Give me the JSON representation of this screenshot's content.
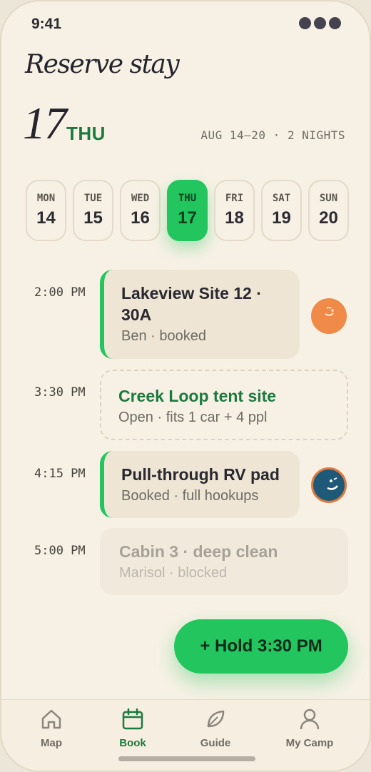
{
  "status_bar": {
    "time": "9:41"
  },
  "header": {
    "title": "Reserve stay",
    "day_number": "17",
    "day_name": "THU",
    "range": "AUG 14–20 · 2 NIGHTS"
  },
  "days": [
    {
      "dow": "MON",
      "num": "14",
      "selected": false
    },
    {
      "dow": "TUE",
      "num": "15",
      "selected": false
    },
    {
      "dow": "WED",
      "num": "16",
      "selected": false
    },
    {
      "dow": "THU",
      "num": "17",
      "selected": true
    },
    {
      "dow": "FRI",
      "num": "18",
      "selected": false
    },
    {
      "dow": "SAT",
      "num": "19",
      "selected": false
    },
    {
      "dow": "SUN",
      "num": "20",
      "selected": false
    }
  ],
  "slots": [
    {
      "time": "2:00 PM",
      "title": "Lakeview Site 12 · 30A",
      "subtitle": "Ben · booked",
      "state": "booked"
    },
    {
      "time": "3:30 PM",
      "title": "Creek Loop tent site",
      "subtitle": "Open · fits 1 car + 4 ppl",
      "state": "open"
    },
    {
      "time": "4:15 PM",
      "title": "Pull-through RV pad",
      "subtitle": "Booked · full hookups",
      "state": "booked"
    },
    {
      "time": "5:00 PM",
      "title": "Cabin 3 · deep clean",
      "subtitle": "Marisol · blocked",
      "state": "blocked"
    }
  ],
  "fab": {
    "label": "+ Hold 3:30 PM"
  },
  "nav": [
    {
      "label": "Map",
      "icon": "home-icon",
      "active": false
    },
    {
      "label": "Book",
      "icon": "calendar-icon",
      "active": true
    },
    {
      "label": "Guide",
      "icon": "leaf-icon",
      "active": false
    },
    {
      "label": "My Camp",
      "icon": "user-icon",
      "active": false
    }
  ],
  "colors": {
    "accent": "#22c55e",
    "accent_dark": "#1d7a3f",
    "background": "#f7f1e5"
  }
}
